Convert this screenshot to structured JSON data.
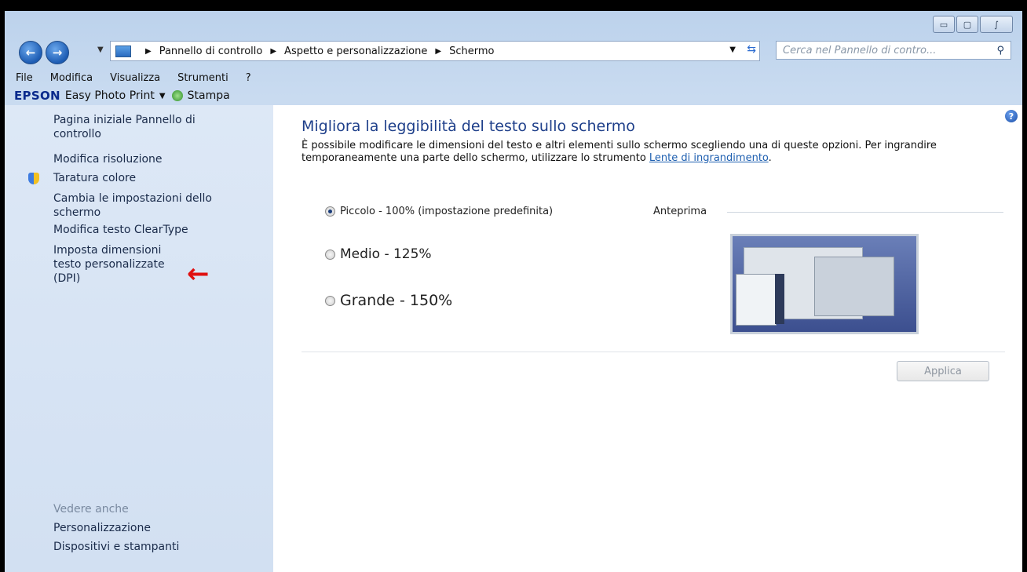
{
  "window": {
    "minimize_icon": "minimize-icon",
    "maximize_icon": "maximize-icon",
    "close_icon": "close-icon"
  },
  "address_bar": {
    "crumbs": [
      "Pannello di controllo",
      "Aspetto e personalizzazione",
      "Schermo"
    ],
    "search_placeholder": "Cerca nel Pannello di contro..."
  },
  "menu": {
    "items": [
      "File",
      "Modifica",
      "Visualizza",
      "Strumenti",
      "?"
    ]
  },
  "toolbar": {
    "brand": "EPSON",
    "app": "Easy Photo Print",
    "stampa": "Stampa"
  },
  "sidebar": {
    "items": [
      "Pagina iniziale Pannello di controllo",
      "Modifica risoluzione",
      "Taratura colore",
      "Cambia le impostazioni dello schermo",
      "Modifica testo ClearType",
      "Imposta dimensioni testo personalizzate (DPI)"
    ],
    "see_also_title": "Vedere anche",
    "see_also": [
      "Personalizzazione",
      "Dispositivi e stampanti"
    ]
  },
  "main": {
    "title": "Migliora la leggibilità del testo sullo schermo",
    "description": "È possibile modificare le dimensioni del testo e altri elementi sullo schermo scegliendo una di queste opzioni. Per ingrandire temporaneamente una parte dello schermo, utilizzare lo strumento",
    "link": "Lente di ingrandimento",
    "after_link": ".",
    "options": [
      {
        "label": "Piccolo - 100% (impostazione predefinita)",
        "selected": true
      },
      {
        "label": "Medio - 125%",
        "selected": false
      },
      {
        "label": "Grande - 150%",
        "selected": false
      }
    ],
    "preview_label": "Anteprima",
    "apply_button": "Applica"
  }
}
